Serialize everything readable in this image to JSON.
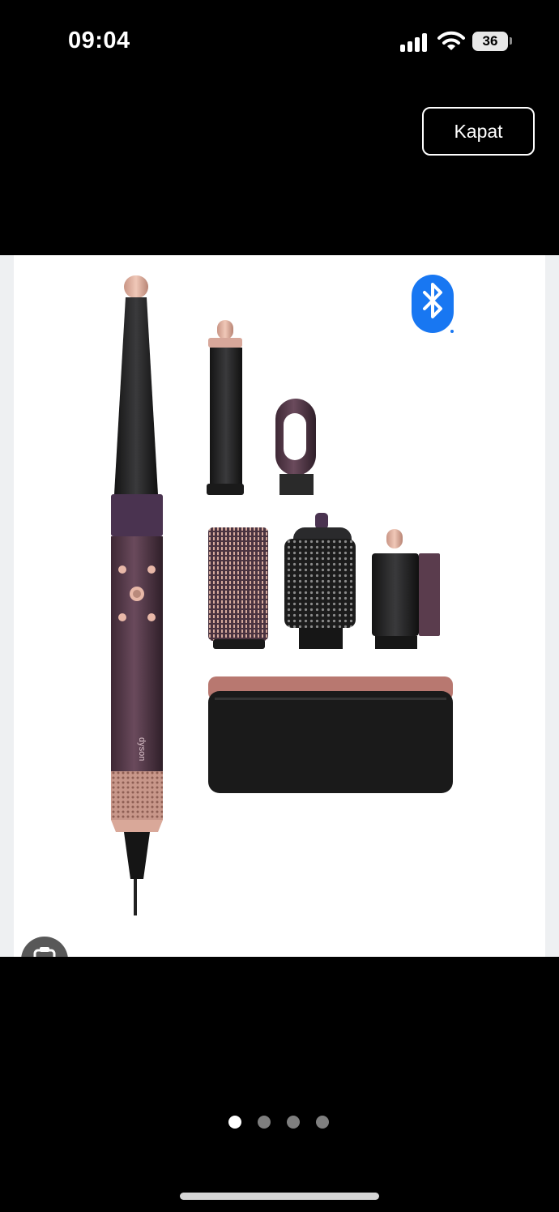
{
  "status_bar": {
    "time": "09:04",
    "battery_level": "36",
    "signal_icon": "cellular-signal-icon",
    "wifi_icon": "wifi-icon"
  },
  "viewer": {
    "close_label": "Kapat",
    "product_image_alt": "Dyson Airwrap hair styler set with attachments and storage case",
    "logo_text": "dyson",
    "bluetooth_icon": "bluetooth-icon",
    "lens_icon": "visual-search-icon"
  },
  "pager": {
    "total_pages": 4,
    "current_page": 1
  },
  "colors": {
    "accent_rose": "#d7a79a",
    "body_mauve": "#5a3c4d",
    "bluetooth_blue": "#1877f2"
  }
}
